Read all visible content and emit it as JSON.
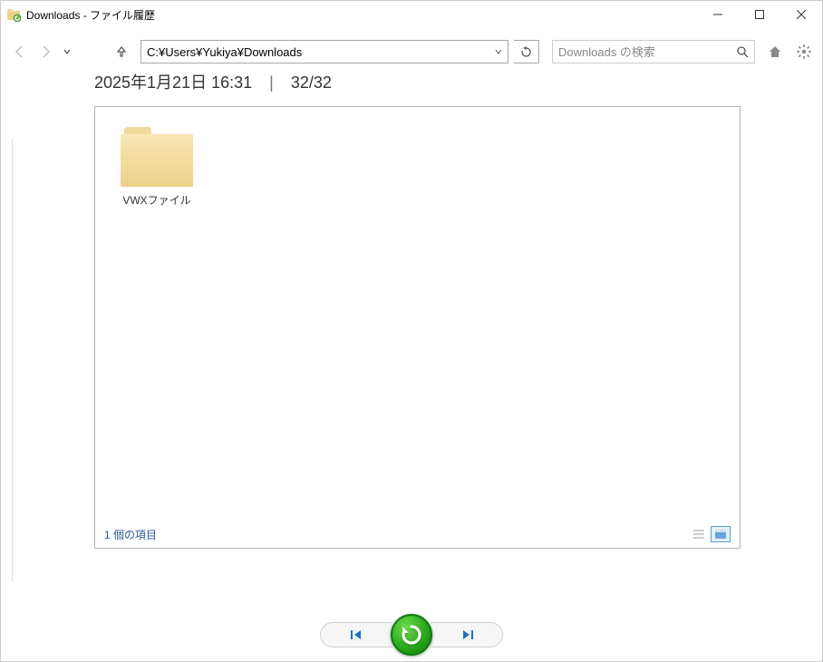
{
  "window": {
    "title": "Downloads - ファイル履歴"
  },
  "toolbar": {
    "path": "C:¥Users¥Yukiya¥Downloads",
    "search_placeholder": "Downloads の検索"
  },
  "timestamp": {
    "date": "2025年1月21日 16:31",
    "position": "32/32"
  },
  "items": [
    {
      "name": "VWXファイル"
    }
  ],
  "status": {
    "count_label": "1 個の項目"
  }
}
